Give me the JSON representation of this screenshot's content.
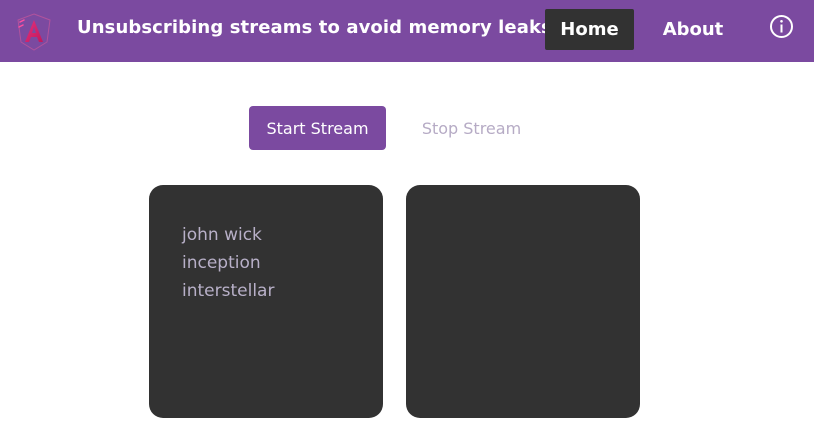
{
  "header": {
    "logo_icon": "angular-logo-icon",
    "title": "Unsubscribing streams to avoid memory leaks",
    "nav": [
      {
        "label": "Home",
        "active": true
      },
      {
        "label": "About",
        "active": false
      }
    ],
    "info_icon": "info-circle-icon"
  },
  "controls": {
    "start_label": "Start Stream",
    "stop_label": "Stop Stream"
  },
  "panels": {
    "left_items": [
      "john wick",
      "inception",
      "interstellar"
    ],
    "right_items": []
  },
  "colors": {
    "brand": "#7b4aa0",
    "panel_bg": "#323232",
    "active_nav_bg": "#323232",
    "disabled_text": "#b6abc5",
    "list_text": "#b8b0c8"
  }
}
